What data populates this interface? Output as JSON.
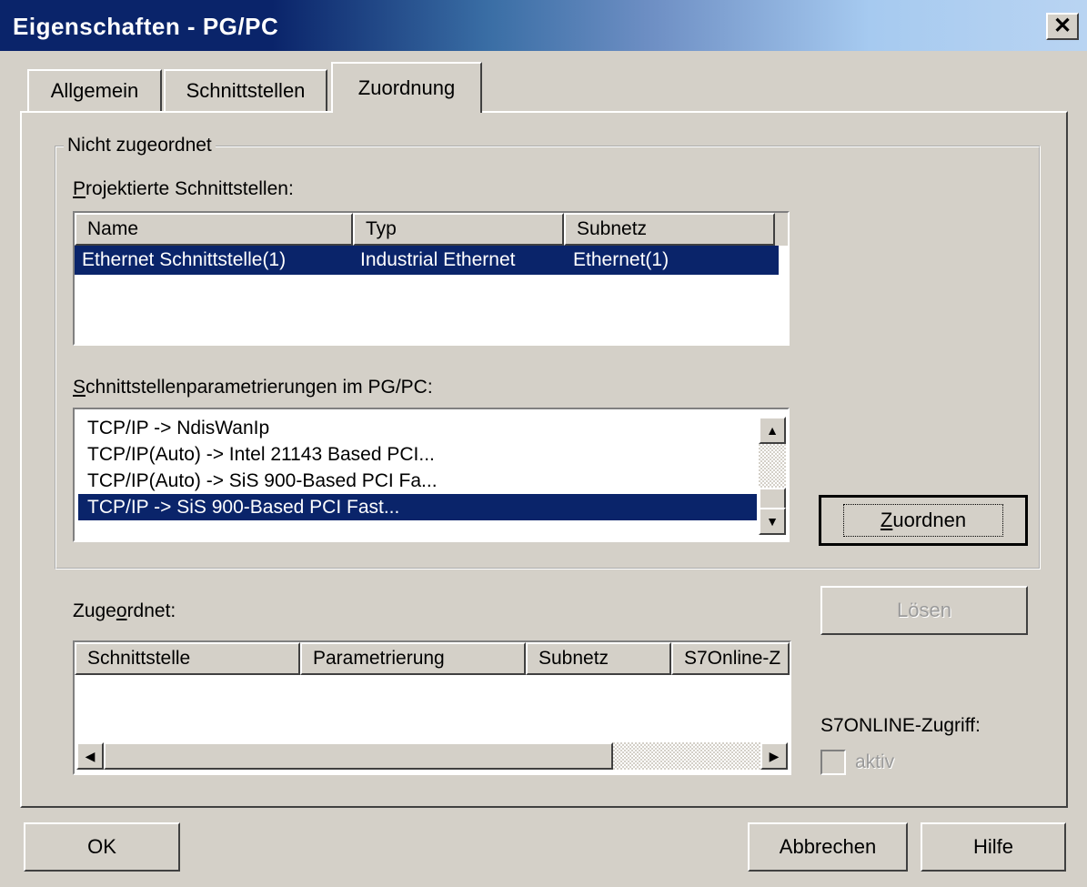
{
  "window": {
    "title": "Eigenschaften - PG/PC",
    "close_glyph": "✕"
  },
  "tabs": [
    {
      "label": "Allgemein"
    },
    {
      "label": "Schnittstellen"
    },
    {
      "label": "Zuordnung"
    }
  ],
  "group": {
    "legend": "Nicht zugeordnet",
    "projected_label_prefix": "P",
    "projected_label_rest": "rojektierte Schnittstellen:",
    "projected_columns": [
      "Name",
      "Typ",
      "Subnetz"
    ],
    "projected_rows": [
      {
        "name": "Ethernet Schnittstelle(1)",
        "type": "Industrial Ethernet",
        "subnet": "Ethernet(1)"
      }
    ],
    "param_label_prefix": "S",
    "param_label_rest": "chnittstellenparametrierungen im PG/PC:",
    "param_items": [
      "TCP/IP -> NdisWanIp",
      "TCP/IP(Auto) -> Intel 21143 Based PCI...",
      "TCP/IP(Auto) -> SiS 900-Based PCI Fa...",
      "TCP/IP -> SiS 900-Based PCI Fast..."
    ],
    "assign_button_prefix": "Z",
    "assign_button_rest": "uordnen"
  },
  "assigned": {
    "label_pre": "Zuge",
    "label_accel": "o",
    "label_post": "rdnet:",
    "columns": [
      "Schnittstelle",
      "Parametrierung",
      "Subnetz",
      "S7Online-Z"
    ],
    "release_button": "Lösen",
    "s7online_label": "S7ONLINE-Zugriff:",
    "active_checkbox_label": "aktiv",
    "active_checked": false
  },
  "footer": {
    "ok": "OK",
    "cancel": "Abbrechen",
    "help": "Hilfe"
  },
  "colors": {
    "selection": "#0a246a",
    "face": "#d4d0c8"
  }
}
